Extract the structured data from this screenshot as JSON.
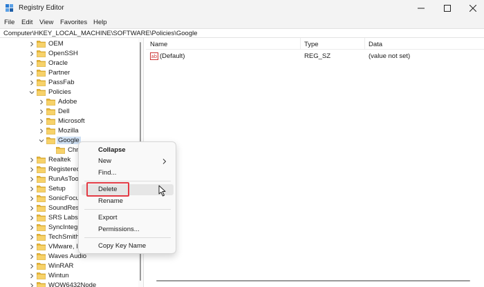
{
  "window": {
    "title": "Registry Editor",
    "controls": [
      "minimize",
      "maximize",
      "close"
    ]
  },
  "menu": [
    "File",
    "Edit",
    "View",
    "Favorites",
    "Help"
  ],
  "address": "Computer\\HKEY_LOCAL_MACHINE\\SOFTWARE\\Policies\\Google",
  "tree": [
    {
      "label": "OEM",
      "expanded": false
    },
    {
      "label": "OpenSSH",
      "expanded": false
    },
    {
      "label": "Oracle",
      "expanded": false
    },
    {
      "label": "Partner",
      "expanded": false
    },
    {
      "label": "PassFab",
      "expanded": false
    },
    {
      "label": "Policies",
      "expanded": true
    },
    {
      "label": "Adobe",
      "expanded": false
    },
    {
      "label": "Dell",
      "expanded": false
    },
    {
      "label": "Microsoft",
      "expanded": false
    },
    {
      "label": "Mozilla",
      "expanded": false
    },
    {
      "label": "Google",
      "expanded": true,
      "selected": true
    },
    {
      "label": "Chro",
      "expanded": null
    },
    {
      "label": "Realtek",
      "expanded": false
    },
    {
      "label": "Registered",
      "expanded": false
    },
    {
      "label": "RunAsToo",
      "expanded": false
    },
    {
      "label": "Setup",
      "expanded": false
    },
    {
      "label": "SonicFocu",
      "expanded": false
    },
    {
      "label": "SoundRese",
      "expanded": false
    },
    {
      "label": "SRS Labs",
      "expanded": false
    },
    {
      "label": "SyncIntegr",
      "expanded": false
    },
    {
      "label": "TechSmith",
      "expanded": false
    },
    {
      "label": "VMware, I",
      "expanded": false
    },
    {
      "label": "Waves Audio",
      "expanded": false
    },
    {
      "label": "WinRAR",
      "expanded": false
    },
    {
      "label": "Wintun",
      "expanded": false
    },
    {
      "label": "WOW6432Node",
      "expanded": false
    }
  ],
  "list": {
    "columns": [
      "Name",
      "Type",
      "Data"
    ],
    "rows": [
      {
        "name": "(Default)",
        "type": "REG_SZ",
        "data": "(value not set)"
      }
    ]
  },
  "context_menu": {
    "items": [
      "Collapse",
      "New",
      "Find...",
      "Delete",
      "Rename",
      "Export",
      "Permissions...",
      "Copy Key Name"
    ],
    "highlighted": "Delete",
    "highlight_color": "#e33a44"
  }
}
